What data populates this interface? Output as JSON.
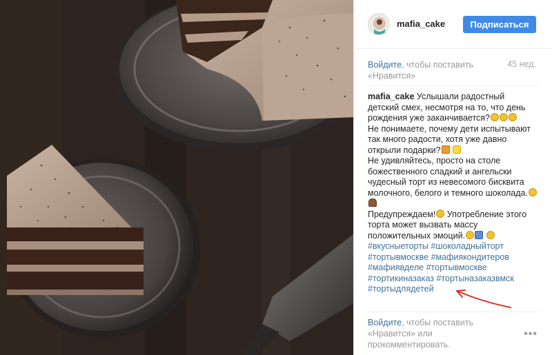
{
  "header": {
    "username": "mafia_cake",
    "follow_label": "Подписаться"
  },
  "like_prompt": {
    "login_link": "Войдите",
    "rest_line1": ", чтобы поставить",
    "rest_line2": "«Нравится»"
  },
  "time": "45 нед.",
  "caption": {
    "username": "mafia_cake",
    "lines": [
      " Услышали радостный",
      "детский смех, несмотря на то, что день",
      "рождения уже заканчивается?",
      "Не понимаете, почему дети испытывают",
      "так много радости, хотя уже давно",
      "открыли подарки?",
      "Не удивляйтесь, просто на столе",
      "божественного сладкий и ангельски",
      "чудесный торт из невесомого бисквита",
      "молочного, белого и темного шоколада.",
      "",
      "Предупреждаем!",
      "торта может вызвать массу",
      "положительных эмоций."
    ],
    "warn_rest": " Употребление этого",
    "hashtags": [
      "#вкусныеторты #шоколадныйторт",
      "#тортывмоскве #мафиякондитеров",
      "#мафиявделе #тортывмоскве",
      "#тортикиназаказ #тортыназаказвмск",
      "#тортыдлядетей"
    ],
    "emoji_names": [
      "grinning-face-icon",
      "gift-icon",
      "sparkle-icon",
      "face-icon",
      "cake-icon",
      "smiley-icon",
      "box-icon"
    ]
  },
  "comment_prompt": {
    "login_link": "Войдите",
    "rest_line1": ", чтобы поставить",
    "rest_line2": "«Нравится» или",
    "rest_line3": "прокомментировать."
  },
  "more_label": "•••",
  "colors": {
    "follow_button": "#3f8ae5",
    "link": "#3f729b",
    "muted": "#999999",
    "annotation_arrow": "#d8322a"
  }
}
